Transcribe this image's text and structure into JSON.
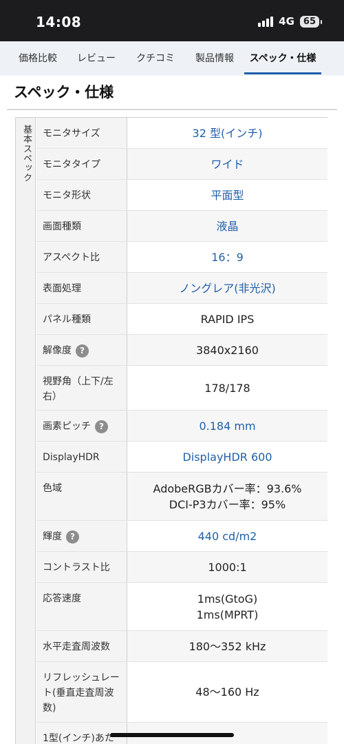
{
  "status": {
    "time": "14:08",
    "network": "4G",
    "battery": "65"
  },
  "tabs": [
    {
      "label": "価格比較"
    },
    {
      "label": "レビュー"
    },
    {
      "label": "クチコミ"
    },
    {
      "label": "製品情報"
    },
    {
      "label": "スペック・仕様"
    }
  ],
  "section_title": "スペック・仕様",
  "group_label": "基本スペック",
  "specs": [
    {
      "label": "モニタサイズ",
      "value": "32 型(インチ)"
    },
    {
      "label": "モニタタイプ",
      "value": "ワイド"
    },
    {
      "label": "モニタ形状",
      "value": "平面型"
    },
    {
      "label": "画面種類",
      "value": "液晶"
    },
    {
      "label": "アスペクト比",
      "value": "16：9"
    },
    {
      "label": "表面処理",
      "value": "ノングレア(非光沢)"
    },
    {
      "label": "パネル種類",
      "value": "RAPID IPS"
    },
    {
      "label": "解像度",
      "value": "3840x2160"
    },
    {
      "label": "視野角（上下/左右）",
      "value": "178/178"
    },
    {
      "label": "画素ピッチ",
      "value": "0.184 mm"
    },
    {
      "label": "DisplayHDR",
      "value": "DisplayHDR 600"
    },
    {
      "label": "色域",
      "value": "AdobeRGBカバー率：93.6%",
      "value2": "DCI-P3カバー率：95%"
    },
    {
      "label": "輝度",
      "value": "440 cd/m2"
    },
    {
      "label": "コントラスト比",
      "value": "1000:1"
    },
    {
      "label": "応答速度",
      "value": "1ms(GtoG)",
      "value2": "1ms(MPRT)"
    },
    {
      "label": "水平走査周波数",
      "value": "180〜352 kHz"
    },
    {
      "label": "リフレッシュレート(垂直走査周波数)",
      "value": "48〜160 Hz"
    },
    {
      "label": "1型(インチ)あた",
      "value": ""
    }
  ],
  "help_icon": "?",
  "colors": {
    "link": "#1f5fa8",
    "tab_active_underline": "#1f5fa8",
    "status_bar": "#1c1c1e"
  }
}
